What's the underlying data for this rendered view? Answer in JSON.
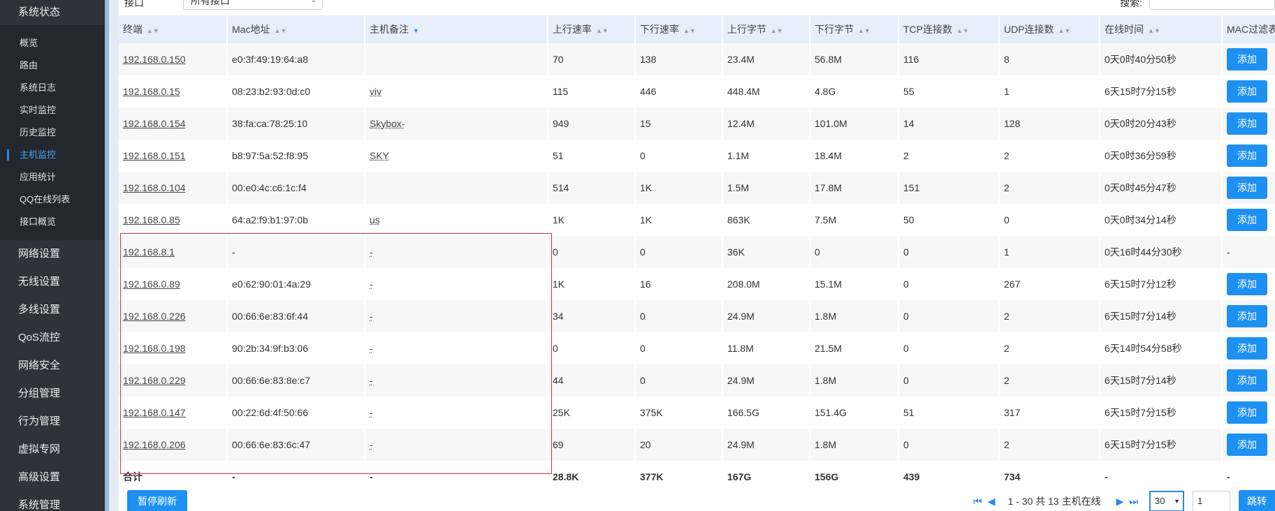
{
  "sidebar": {
    "group_title": "系统状态",
    "subitems": [
      {
        "label": "概览"
      },
      {
        "label": "路由"
      },
      {
        "label": "系统日志"
      },
      {
        "label": "实时监控"
      },
      {
        "label": "历史监控"
      },
      {
        "label": "主机监控"
      },
      {
        "label": "应用统计"
      },
      {
        "label": "QQ在线列表"
      },
      {
        "label": "接口概览"
      }
    ],
    "active_subitem": "主机监控",
    "menu": [
      {
        "label": "网络设置"
      },
      {
        "label": "无线设置"
      },
      {
        "label": "多线设置"
      },
      {
        "label": "QoS流控"
      },
      {
        "label": "网络安全"
      },
      {
        "label": "分组管理"
      },
      {
        "label": "行为管理"
      },
      {
        "label": "虚拟专网"
      },
      {
        "label": "高级设置"
      },
      {
        "label": "系统管理"
      }
    ]
  },
  "filter": {
    "label": "接口",
    "select_value": "所有接口",
    "search_label": "搜索:"
  },
  "table": {
    "headers": [
      "终端",
      "Mac地址",
      "主机备注",
      "上行速率",
      "下行速率",
      "上行字节",
      "下行字节",
      "TCP连接数",
      "UDP连接数",
      "在线时间",
      "MAC过滤表"
    ],
    "rows": [
      {
        "ip": "192.168.0.150",
        "mac": "e0:3f:49:19:64:a8",
        "note": "",
        "up_rate": "70",
        "down_rate": "138",
        "up_bytes": "23.4M",
        "down_bytes": "56.8M",
        "tcp": "116",
        "udp": "8",
        "online": "0天0时40分50秒",
        "action": "添加"
      },
      {
        "ip": "192.168.0.15",
        "mac": "08:23:b2:93:0d:c0",
        "note": "viv",
        "up_rate": "115",
        "down_rate": "446",
        "up_bytes": "448.4M",
        "down_bytes": "4.8G",
        "tcp": "55",
        "udp": "1",
        "online": "6天15时7分15秒",
        "action": "添加"
      },
      {
        "ip": "192.168.0.154",
        "mac": "38:fa:ca:78:25:10",
        "note": "Skybox-",
        "up_rate": "949",
        "down_rate": "15",
        "up_bytes": "12.4M",
        "down_bytes": "101.0M",
        "tcp": "14",
        "udp": "128",
        "online": "0天0时20分43秒",
        "action": "添加"
      },
      {
        "ip": "192.168.0.151",
        "mac": "b8:97:5a:52:f8:95",
        "note": "SKY",
        "up_rate": "51",
        "down_rate": "0",
        "up_bytes": "1.1M",
        "down_bytes": "18.4M",
        "tcp": "2",
        "udp": "2",
        "online": "0天0时36分59秒",
        "action": "添加"
      },
      {
        "ip": "192.168.0.104",
        "mac": "00:e0:4c:c6:1c:f4",
        "note": "",
        "up_rate": "514",
        "down_rate": "1K",
        "up_bytes": "1.5M",
        "down_bytes": "17.8M",
        "tcp": "151",
        "udp": "2",
        "online": "0天0时45分47秒",
        "action": "添加"
      },
      {
        "ip": "192.168.0.85",
        "mac": "64:a2:f9:b1:97:0b",
        "note": "us",
        "up_rate": "1K",
        "down_rate": "1K",
        "up_bytes": "863K",
        "down_bytes": "7.5M",
        "tcp": "50",
        "udp": "0",
        "online": "0天0时34分14秒",
        "action": "添加"
      },
      {
        "ip": "192.168.8.1",
        "mac": "-",
        "note": "-",
        "up_rate": "0",
        "down_rate": "0",
        "up_bytes": "36K",
        "down_bytes": "0",
        "tcp": "0",
        "udp": "1",
        "online": "0天16时44分30秒",
        "action": "-"
      },
      {
        "ip": "192.168.0.89",
        "mac": "e0:62:90:01:4a:29",
        "note": "-",
        "up_rate": "1K",
        "down_rate": "16",
        "up_bytes": "208.0M",
        "down_bytes": "15.1M",
        "tcp": "0",
        "udp": "267",
        "online": "6天15时7分12秒",
        "action": "添加"
      },
      {
        "ip": "192.168.0.226",
        "mac": "00:66:6e:83:6f:44",
        "note": "-",
        "up_rate": "34",
        "down_rate": "0",
        "up_bytes": "24.9M",
        "down_bytes": "1.8M",
        "tcp": "0",
        "udp": "2",
        "online": "6天15时7分14秒",
        "action": "添加"
      },
      {
        "ip": "192.168.0.198",
        "mac": "90:2b:34:9f:b3:06",
        "note": "-",
        "up_rate": "0",
        "down_rate": "0",
        "up_bytes": "11.8M",
        "down_bytes": "21.5M",
        "tcp": "0",
        "udp": "2",
        "online": "6天14时54分58秒",
        "action": "添加"
      },
      {
        "ip": "192.168.0.229",
        "mac": "00:66:6e:83:8e:c7",
        "note": "-",
        "up_rate": "44",
        "down_rate": "0",
        "up_bytes": "24.9M",
        "down_bytes": "1.8M",
        "tcp": "0",
        "udp": "2",
        "online": "6天15时7分14秒",
        "action": "添加"
      },
      {
        "ip": "192.168.0.147",
        "mac": "00:22:6d:4f:50:66",
        "note": "-",
        "up_rate": "25K",
        "down_rate": "375K",
        "up_bytes": "166.5G",
        "down_bytes": "151.4G",
        "tcp": "51",
        "udp": "317",
        "online": "6天15时7分15秒",
        "action": "添加"
      },
      {
        "ip": "192.168.0.206",
        "mac": "00:66:6e:83:6c:47",
        "note": "-",
        "up_rate": "69",
        "down_rate": "20",
        "up_bytes": "24.9M",
        "down_bytes": "1.8M",
        "tcp": "0",
        "udp": "2",
        "online": "6天15时7分15秒",
        "action": "添加"
      }
    ],
    "total": {
      "label": "合计",
      "mac": "-",
      "note": "-",
      "up_rate": "28.8K",
      "down_rate": "377K",
      "up_bytes": "167G",
      "down_bytes": "156G",
      "tcp": "439",
      "udp": "734",
      "online": "-",
      "action": "-"
    }
  },
  "bottom": {
    "pause_label": "暂停刷新",
    "page_info": "1 - 30 共 13 主机在线",
    "page_size": "30",
    "page_number": "1",
    "jump_label": "跳转"
  },
  "colors": {
    "accent": "#1e90f2",
    "sidebar_bg": "#2d323b",
    "header_bg": "#e6eff9",
    "highlight_box": "#d9363e"
  }
}
